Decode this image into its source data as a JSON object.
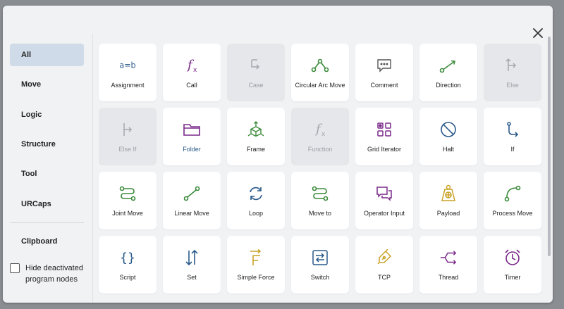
{
  "sidebar": {
    "items": [
      {
        "label": "All",
        "active": true
      },
      {
        "label": "Move"
      },
      {
        "label": "Logic"
      },
      {
        "label": "Structure"
      },
      {
        "label": "Tool"
      },
      {
        "label": "URCaps"
      }
    ],
    "clipboard": "Clipboard",
    "hide_deactivated": "Hide deactivated program nodes"
  },
  "tiles": [
    {
      "label": "Assignment",
      "icon": "assignment-icon",
      "color": "#2a5a8a"
    },
    {
      "label": "Call",
      "icon": "function-call-icon",
      "color": "#7a2a8a"
    },
    {
      "label": "Case",
      "icon": "case-icon",
      "disabled": true
    },
    {
      "label": "Circular Arc Move",
      "icon": "circular-arc-icon",
      "color": "#3a8a3a"
    },
    {
      "label": "Comment",
      "icon": "comment-icon",
      "color": "#555555"
    },
    {
      "label": "Direction",
      "icon": "direction-icon",
      "color": "#3a8a3a"
    },
    {
      "label": "Else",
      "icon": "else-icon",
      "disabled": true
    },
    {
      "label": "Else If",
      "icon": "else-if-icon",
      "disabled": true
    },
    {
      "label": "Folder",
      "icon": "folder-icon",
      "color": "#7a2a8a"
    },
    {
      "label": "Frame",
      "icon": "frame-icon",
      "color": "#3a8a3a"
    },
    {
      "label": "Function",
      "icon": "function-icon",
      "disabled": true
    },
    {
      "label": "Grid Iterator",
      "icon": "grid-iterator-icon",
      "color": "#7a2a8a"
    },
    {
      "label": "Halt",
      "icon": "halt-icon",
      "color": "#2a5a8a"
    },
    {
      "label": "If",
      "icon": "if-icon",
      "color": "#2a5a8a"
    },
    {
      "label": "Joint Move",
      "icon": "joint-move-icon",
      "color": "#3a8a3a"
    },
    {
      "label": "Linear Move",
      "icon": "linear-move-icon",
      "color": "#3a8a3a"
    },
    {
      "label": "Loop",
      "icon": "loop-icon",
      "color": "#2a5a8a"
    },
    {
      "label": "Move to",
      "icon": "move-to-icon",
      "color": "#3a8a3a"
    },
    {
      "label": "Operator Input",
      "icon": "operator-input-icon",
      "color": "#7a2a8a"
    },
    {
      "label": "Payload",
      "icon": "payload-icon",
      "color": "#c9a227"
    },
    {
      "label": "Process Move",
      "icon": "process-move-icon",
      "color": "#3a8a3a"
    },
    {
      "label": "Script",
      "icon": "script-icon",
      "color": "#2a5a8a"
    },
    {
      "label": "Set",
      "icon": "set-icon",
      "color": "#2a5a8a"
    },
    {
      "label": "Simple Force",
      "icon": "simple-force-icon",
      "color": "#c9a227"
    },
    {
      "label": "Switch",
      "icon": "switch-icon",
      "color": "#2a5a8a"
    },
    {
      "label": "TCP",
      "icon": "tcp-icon",
      "color": "#c9a227"
    },
    {
      "label": "Thread",
      "icon": "thread-icon",
      "color": "#7a2a8a"
    },
    {
      "label": "Timer",
      "icon": "timer-icon",
      "color": "#7a2a8a"
    }
  ],
  "colors": {
    "active_bg": "#cfdbe8",
    "tile_bg": "#ffffff",
    "disabled_bg": "#e6e7ea",
    "blue": "#2a5a8a",
    "green": "#3a8a3a",
    "purple": "#7a2a8a",
    "gold": "#c9a227"
  }
}
